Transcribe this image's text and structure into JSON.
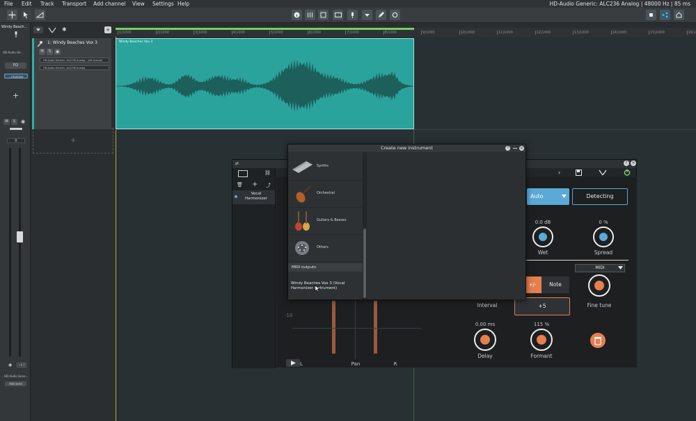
{
  "menubar": {
    "items": [
      "File",
      "Edit",
      "Track",
      "Transport",
      "Add channel",
      "View",
      "Settings",
      "Help"
    ],
    "status": "HD-Audio Generic: ALC236 Analog | 48000 Hz | 85 ms"
  },
  "strip": {
    "track_name": "Windy Beach...",
    "output": "HD-Audio Ge...",
    "eq_label": "EQ",
    "insert_label": "...rmonizer",
    "mute": "M",
    "solo": "S",
    "fader_value": "0",
    "pan_value": "+0.0",
    "bottom_output": "HD-Audio Gene...",
    "add_send": "Add send"
  },
  "track": {
    "name": "1: Windy Beaches Vox 3",
    "mute": "M",
    "solo": "S",
    "input": "HD-Audio Generic: ALC236 Analog - Left channel",
    "output": "HD-Audio Generic: ALC236 Analog"
  },
  "ruler": {
    "ticks": [
      "1|1000",
      "2|1000",
      "3|1000",
      "4|1000",
      "5|1000",
      "6|1000",
      "7|1000",
      "8|1000",
      "9|1000",
      "10|1000",
      "11|1000",
      "12|1000",
      "13|1000",
      "14|1000",
      "15|1000",
      "16|1000"
    ]
  },
  "clip": {
    "name": "Windy Beaches Vox 3"
  },
  "plugin": {
    "list_item": "Vocal Harmonizer",
    "buttons": {
      "auto": "Auto",
      "detecting": "Detecting",
      "note": "Note",
      "plusminus": "+/-",
      "midi": "MIDI"
    },
    "knobs": {
      "wet_value": "0.0 dB",
      "wet_label": "Wet",
      "spread_value": "0 %",
      "spread_label": "Spread",
      "fine_tune_label": "Fine tune",
      "delay_value": "0.00 ms",
      "delay_label": "Delay",
      "formant_value": "115 %",
      "formant_label": "Formant"
    },
    "interval_label": "Interval",
    "interval_value": "+5",
    "meter_tick": "-10",
    "pan_label": "Pan",
    "pan_left": "L",
    "pan_right": "R"
  },
  "dialog": {
    "title": "Create new instrument",
    "categories": [
      "Synths",
      "Orchestral",
      "Guitars & Basses",
      "Others"
    ],
    "section": "MIDI outputs",
    "midi_output": "Windy Beaches Vox 3 (Vocal Harmonizer Instrument)"
  },
  "colors": {
    "clip": "#2aa39c",
    "accent_orange": "#e57f4f",
    "accent_blue": "#5aa9d6",
    "power_green": "#7ad36c"
  }
}
